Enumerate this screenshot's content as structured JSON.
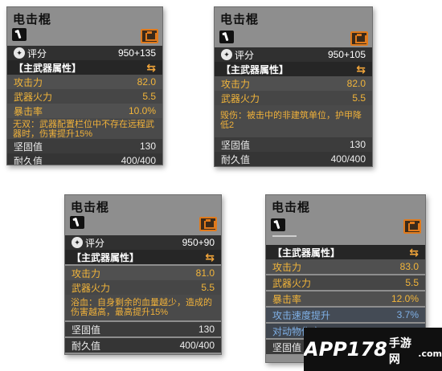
{
  "cards": [
    {
      "title": "电击棍",
      "rating_label": "评分",
      "rating_value": "950+135",
      "section_label": "【主武器属性】",
      "stats": [
        {
          "label": "攻击力",
          "value": "82.0"
        },
        {
          "label": "武器火力",
          "value": "5.5"
        },
        {
          "label": "暴击率",
          "value": "10.0%"
        }
      ],
      "note": "无双：武器配置栏位中不存在远程武器时，伤害提升15%",
      "durability": [
        {
          "label": "坚固值",
          "value": "130"
        },
        {
          "label": "耐久值",
          "value": "400/400"
        }
      ]
    },
    {
      "title": "电击棍",
      "rating_label": "评分",
      "rating_value": "950+105",
      "section_label": "【主武器属性】",
      "stats": [
        {
          "label": "攻击力",
          "value": "82.0"
        },
        {
          "label": "武器火力",
          "value": "5.5"
        }
      ],
      "note": "毁伤：被击中的非建筑单位，护甲降低2",
      "durability": [
        {
          "label": "坚固值",
          "value": "130"
        },
        {
          "label": "耐久值",
          "value": "400/400"
        }
      ]
    },
    {
      "title": "电击棍",
      "rating_label": "评分",
      "rating_value": "950+90",
      "section_label": "【主武器属性】",
      "stats": [
        {
          "label": "攻击力",
          "value": "81.0"
        },
        {
          "label": "武器火力",
          "value": "5.5"
        }
      ],
      "note": "浴血：自身剩余的血量越少，造成的伤害越高，最高提升15%",
      "durability": [
        {
          "label": "坚固值",
          "value": "130"
        },
        {
          "label": "耐久值",
          "value": "400/400"
        }
      ]
    },
    {
      "title": "电击棍",
      "section_label": "【主武器属性】",
      "stats": [
        {
          "label": "攻击力",
          "value": "83.0"
        },
        {
          "label": "武器火力",
          "value": "5.5"
        },
        {
          "label": "暴击率",
          "value": "12.0%"
        }
      ],
      "extra_stats": [
        {
          "label": "攻击速度提升",
          "value": "3.7%"
        },
        {
          "label": "对动物伤害"
        }
      ],
      "durability": [
        {
          "label": "坚固值"
        }
      ]
    }
  ],
  "watermark": {
    "main": "APP178",
    "cn": "手游网",
    "domain": ".com"
  }
}
